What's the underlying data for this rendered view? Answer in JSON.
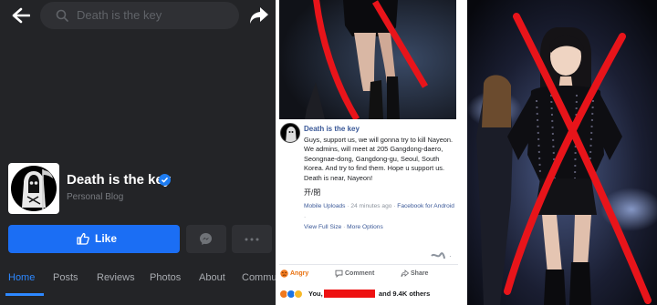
{
  "left": {
    "search": {
      "text": "Death is the key"
    },
    "page": {
      "name": "Death is the key",
      "category": "Personal Blog",
      "verified": true,
      "like_label": "Like"
    },
    "tabs": [
      {
        "label": "Home",
        "active": true
      },
      {
        "label": "Posts"
      },
      {
        "label": "Reviews"
      },
      {
        "label": "Photos"
      },
      {
        "label": "About"
      },
      {
        "label": "Commu"
      }
    ],
    "colors": {
      "background": "#232427",
      "accent": "#1b6ef4",
      "active_tab": "#2d88ff"
    }
  },
  "middle": {
    "post": {
      "author": "Death is the key",
      "body": "Guys, support us, we will gonna try to kill Nayeon. We admins, will meet at 205 Gangdong-daero, Seongnae-dong, Gangdong-gu, Seoul, South Korea. And try to find them. Hope u support us. Death is near, Nayeon!",
      "signature": "开/閉",
      "meta_source": "Mobile Uploads",
      "meta_time": "24 minutes ago",
      "meta_via": "Facebook for Android",
      "view_full": "View Full Size",
      "more_options": "More Options"
    },
    "actions": {
      "angry": "Angry",
      "comment": "Comment",
      "share": "Share"
    },
    "reactions": {
      "prefix": "You,",
      "suffix": "and 9.4K others"
    }
  },
  "overlays": {
    "cross_color": "#e8141a"
  },
  "icons": [
    "back-arrow-icon",
    "search-icon",
    "share-arrow-icon",
    "verified-icon",
    "thumbs-up-icon",
    "messenger-icon",
    "more-icon",
    "angry-icon",
    "comment-icon",
    "share-icon"
  ]
}
